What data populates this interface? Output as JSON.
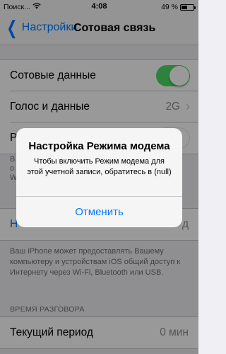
{
  "status_bar": {
    "carrier": "Поиск...",
    "time": "4:08",
    "battery_text": "49 %",
    "battery_level": 0.49
  },
  "nav": {
    "back_label": "Настройки",
    "title": "Сотовая связь"
  },
  "settings": {
    "cellular_data_label": "Сотовые данные",
    "cellular_data_on": true,
    "voice_data_label": "Голос и данные",
    "voice_data_value": "2G",
    "roaming_label_partial": "Р",
    "description_partial": "В\nо\nW",
    "hotspot_link_partial": "Н",
    "hotspot_right_partial": "д",
    "hotspot_footnote": "Ваш iPhone может предоставлять Вашему компьютеру и устройствам iOS общий доступ к Интернету через Wi-Fi, Bluetooth или USB.",
    "call_time_header": "ВРЕМЯ РАЗГОВОРА",
    "current_period_label": "Текущий период",
    "current_period_value": "0 мин"
  },
  "alert": {
    "title": "Настройка Режима модема",
    "message": "Чтобы включить Режим модема для этой учетной записи, обратитесь в (null)",
    "cancel_label": "Отменить"
  },
  "colors": {
    "accent": "#007aff",
    "toggle_on": "#4cd964",
    "background": "#efeff4"
  }
}
